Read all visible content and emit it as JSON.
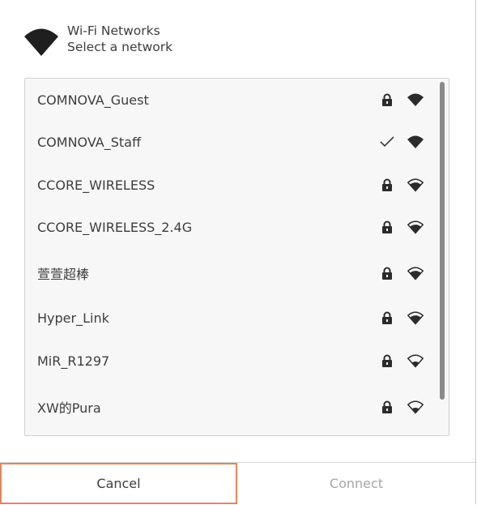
{
  "header": {
    "title": "Wi-Fi Networks",
    "subtitle": "Select a network"
  },
  "networks": [
    {
      "name": "COMNOVA_Guest",
      "status": "lock-icon",
      "signal": "full"
    },
    {
      "name": "COMNOVA_Staff",
      "status": "checkmark-icon",
      "signal": "full"
    },
    {
      "name": "CCORE_WIRELESS",
      "status": "lock-icon",
      "signal": "medium"
    },
    {
      "name": "CCORE_WIRELESS_2.4G",
      "status": "lock-icon",
      "signal": "medium"
    },
    {
      "name": "萱萱超棒",
      "status": "lock-icon",
      "signal": "medium"
    },
    {
      "name": "Hyper_Link",
      "status": "lock-icon",
      "signal": "medium"
    },
    {
      "name": "MiR_R1297",
      "status": "lock-icon",
      "signal": "low"
    },
    {
      "name": "XW的Pura",
      "status": "lock-icon",
      "signal": "low"
    }
  ],
  "footer": {
    "cancel_label": "Cancel",
    "connect_label": "Connect"
  },
  "colors": {
    "focus_border": "#e4865a",
    "text": "#3d3d3d",
    "disabled_text": "#a6a6a6",
    "list_background": "#f7f7f7"
  }
}
